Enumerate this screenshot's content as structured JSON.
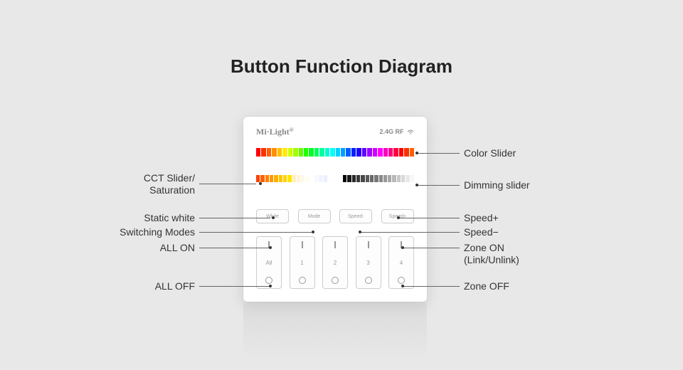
{
  "title": "Button Function Diagram",
  "brand": "Mi·Light",
  "brand_sup": "®",
  "rf": "2.4G RF",
  "mode_buttons": {
    "white": "White",
    "mode": "Mode",
    "speed_minus": "Speed-",
    "speed_plus": "Speed+"
  },
  "zones": [
    "All",
    "1",
    "2",
    "3",
    "4"
  ],
  "labels": {
    "left": {
      "cct": "CCT Slider/\nSaturation",
      "static_white": "Static white",
      "switching_modes": "Switching Modes",
      "all_on": "ALL ON",
      "all_off": "ALL OFF"
    },
    "right": {
      "color_slider": "Color Slider",
      "dimming_slider": "Dimming slider",
      "speed_plus": "Speed+",
      "speed_minus": "Speed−",
      "zone_on": "Zone ON\n(Link/Unlink)",
      "zone_off": "Zone OFF"
    }
  },
  "colors": {
    "rainbow": [
      "#ff0000",
      "#ff3000",
      "#ff6000",
      "#ff9000",
      "#ffc000",
      "#ffee00",
      "#d0ff00",
      "#a0ff00",
      "#60ff00",
      "#20ff00",
      "#00ff20",
      "#00ff60",
      "#00ffa0",
      "#00ffd0",
      "#00ffff",
      "#00d0ff",
      "#00a0ff",
      "#0060ff",
      "#0020ff",
      "#2000ff",
      "#6000ff",
      "#a000ff",
      "#d000ff",
      "#ff00ff",
      "#ff00c0",
      "#ff0080",
      "#ff0040",
      "#ff0000",
      "#ff3000",
      "#ff6000"
    ],
    "cct": [
      "#ff4000",
      "#ff6000",
      "#ff8000",
      "#ff9800",
      "#ffb000",
      "#ffc400",
      "#ffd400",
      "#ffe400",
      "#ffeec0",
      "#fff4d8",
      "#fff8e8",
      "#fffcf2",
      "#ffffff",
      "#f8f8ff",
      "#f0f4ff",
      "#e8f0ff"
    ],
    "dim": [
      "#000000",
      "#181818",
      "#282828",
      "#383838",
      "#484848",
      "#585858",
      "#686868",
      "#787878",
      "#888888",
      "#989898",
      "#a8a8a8",
      "#b8b8b8",
      "#c8c8c8",
      "#d8d8d8",
      "#e8e8e8",
      "#f8f8f8"
    ]
  }
}
